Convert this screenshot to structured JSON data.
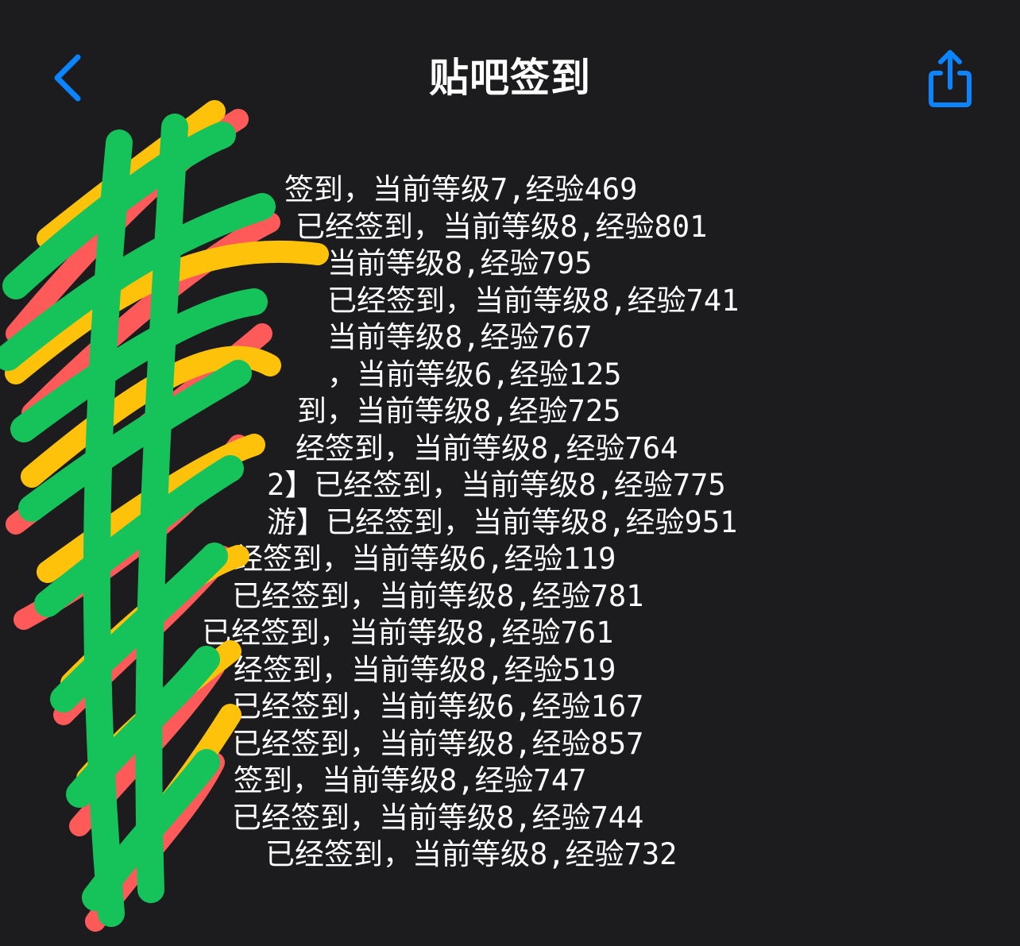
{
  "nav": {
    "title": "贴吧签到",
    "back_icon": "chevron-left-icon",
    "share_icon": "share-icon",
    "accent_color": "#0a84ff"
  },
  "log": {
    "lines": [
      "签到，当前等级7,经验469",
      "已经签到，当前等级8,经验801",
      "当前等级8,经验795",
      "已经签到，当前等级8,经验741",
      "当前等级8,经验767",
      "，当前等级6,经验125",
      "到，当前等级8,经验725",
      "经签到，当前等级8,经验764",
      "2】已经签到，当前等级8,经验775",
      "游】已经签到，当前等级8,经验951",
      "经签到，当前等级6,经验119",
      "已经签到，当前等级8,经验781",
      "已经签到，当前等级8,经验761",
      "经签到，当前等级8,经验519",
      "已经签到，当前等级6,经验167",
      "已经签到，当前等级8,经验857",
      "签到，当前等级8,经验747",
      "已经签到，当前等级8,经验744",
      "已经签到，当前等级8,经验732"
    ]
  },
  "redaction": {
    "colors": [
      "#ff5a5a",
      "#ffc20a",
      "#16c25a"
    ]
  }
}
